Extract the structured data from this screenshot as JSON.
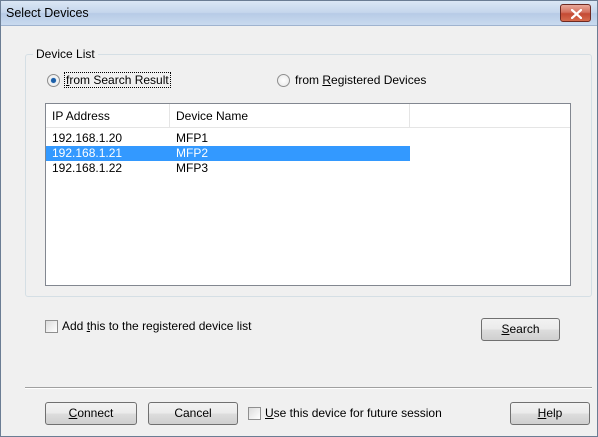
{
  "window": {
    "title": "Select Devices"
  },
  "group": {
    "label": "Device List"
  },
  "radios": {
    "search_result": {
      "pre": "",
      "accel": "f",
      "post": "rom Search Result",
      "checked": true
    },
    "registered": {
      "pre": "from ",
      "accel": "R",
      "post": "egistered Devices",
      "checked": false
    }
  },
  "table": {
    "columns": [
      "IP Address",
      "Device Name"
    ],
    "rows": [
      {
        "ip": "192.168.1.20",
        "name": "MFP1",
        "selected": false
      },
      {
        "ip": "192.168.1.21",
        "name": "MFP2",
        "selected": true
      },
      {
        "ip": "192.168.1.22",
        "name": "MFP3",
        "selected": false
      }
    ]
  },
  "add_registered": {
    "pre": "Add ",
    "accel": "t",
    "post": "his to the registered device list",
    "checked": false
  },
  "search_button": {
    "pre": "",
    "accel": "S",
    "post": "earch"
  },
  "connect_button": {
    "pre": "",
    "accel": "C",
    "post": "onnect"
  },
  "cancel_button": {
    "label": "Cancel"
  },
  "future_session": {
    "pre": "",
    "accel": "U",
    "post": "se this device for future session",
    "checked": false
  },
  "help_button": {
    "pre": "",
    "accel": "H",
    "post": "elp"
  },
  "colors": {
    "selection": "#3399ff",
    "titlebar": "#c5d6ec",
    "close": "#c44a34",
    "face": "#f0f0f0"
  }
}
